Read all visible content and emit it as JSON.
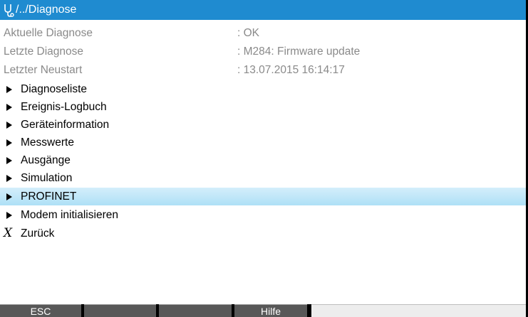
{
  "header": {
    "icon": "diagnosis-stethoscope-icon",
    "path": "/../Diagnose"
  },
  "info": [
    {
      "label": "Aktuelle Diagnose",
      "value": ": OK"
    },
    {
      "label": "Letzte Diagnose",
      "value": ": M284: Firmware update"
    },
    {
      "label": "Letzter Neustart",
      "value": ": 13.07.2015 16:14:17"
    }
  ],
  "menu": [
    {
      "label": "Diagnoseliste",
      "icon": "arrow-right-icon"
    },
    {
      "label": "Ereignis-Logbuch",
      "icon": "arrow-right-icon"
    },
    {
      "label": "Geräteinformation",
      "icon": "arrow-right-icon"
    },
    {
      "label": "Messwerte",
      "icon": "arrow-right-icon"
    },
    {
      "label": "Ausgänge",
      "icon": "arrow-right-icon"
    },
    {
      "label": "Simulation",
      "icon": "arrow-right-icon"
    },
    {
      "label": "PROFINET",
      "icon": "arrow-right-icon",
      "selected": true
    },
    {
      "label": "Modem initialisieren",
      "icon": "arrow-right-icon"
    },
    {
      "label": "Zurück",
      "icon": "back-x-icon"
    }
  ],
  "softkeys": [
    {
      "label": "ESC"
    },
    {
      "label": ""
    },
    {
      "label": ""
    },
    {
      "label": "Hilfe"
    },
    {
      "label": ""
    }
  ],
  "colors": {
    "titlebar": "#1f8bd0",
    "selected_row": "#aee0f6",
    "softkey": "#585858"
  }
}
